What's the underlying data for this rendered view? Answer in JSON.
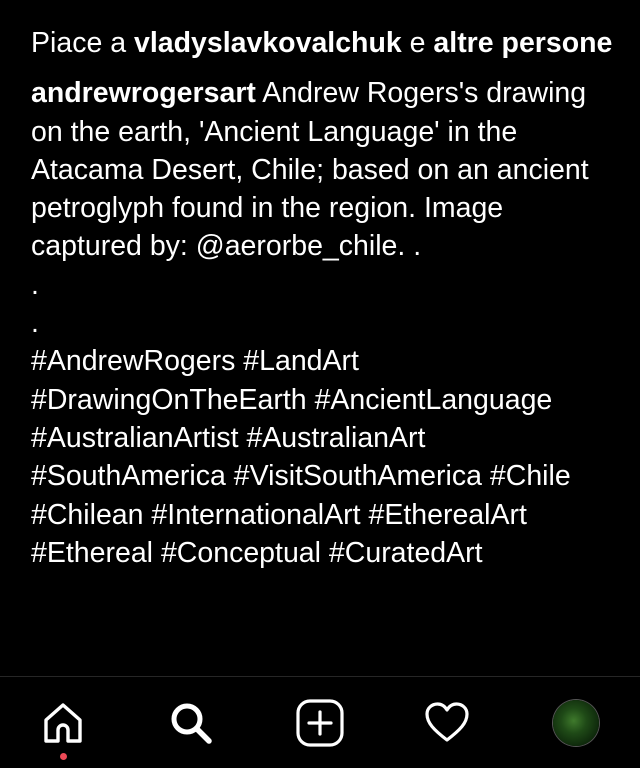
{
  "likes": {
    "prefix": "Piace a ",
    "user": "vladyslavkovalchuk",
    "connector": " e ",
    "others": "altre persone"
  },
  "caption": {
    "username": "andrewrogersart",
    "text": " Andrew Rogers's drawing on the earth, 'Ancient Language' in the Atacama Desert, Chile; based on an ancient petroglyph found in the region. Image captured by: @aerorbe_chile. .\n.\n.",
    "hashtags": [
      "#AndrewRogers",
      "#LandArt",
      "#DrawingOnTheEarth",
      "#AncientLanguage",
      "#AustralianArtist",
      "#AustralianArt",
      "#SouthAmerica",
      "#VisitSouthAmerica",
      "#Chile",
      "#Chilean",
      "#InternationalArt",
      "#EtherealArt",
      "#Ethereal",
      "#Conceptual",
      "#CuratedArt"
    ]
  },
  "tabbar": {
    "home_icon": "home-icon",
    "search_icon": "search-icon",
    "new_post_icon": "new-post-icon",
    "activity_icon": "heart-icon",
    "profile_icon": "avatar",
    "notification_color": "#ed4956"
  },
  "colors": {
    "background": "#000000",
    "text": "#ffffff",
    "notification": "#ed4956"
  }
}
